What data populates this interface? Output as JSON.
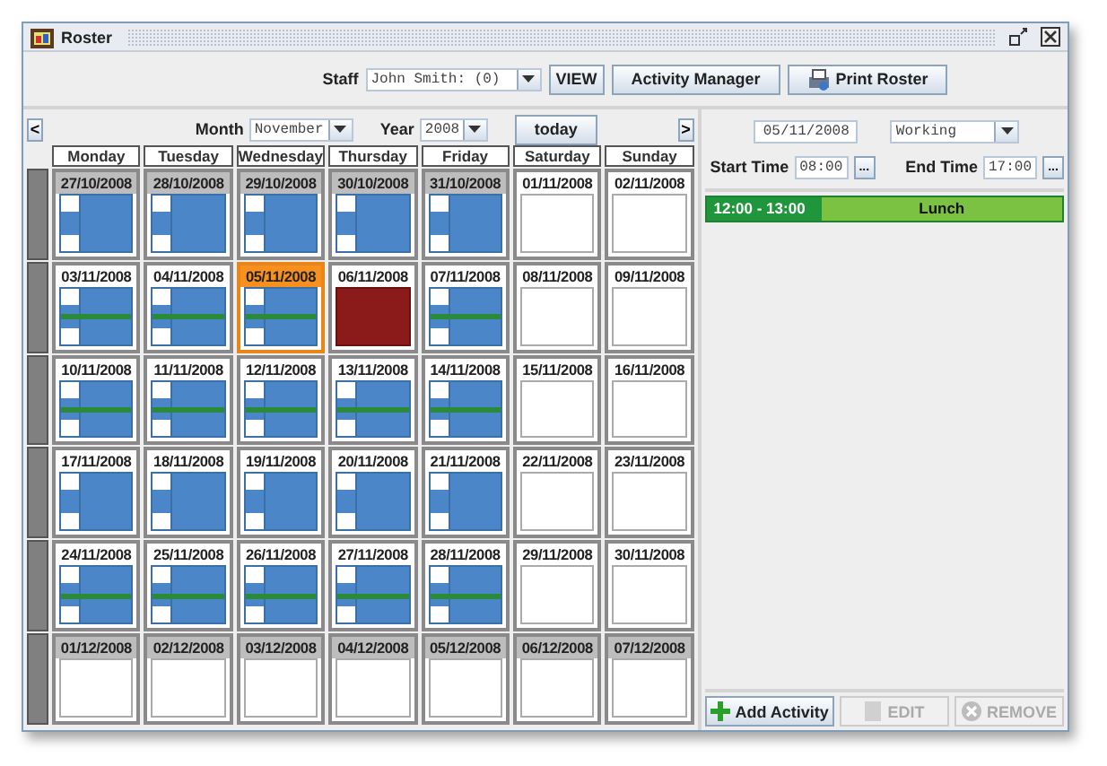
{
  "window": {
    "title": "Roster"
  },
  "toolbar": {
    "staff_label": "Staff",
    "staff_value": "John Smith: (0)",
    "buttons": [
      "VIEW",
      "Activity Manager",
      "Print Roster"
    ]
  },
  "calendar": {
    "prev": "<",
    "next": ">",
    "month_label": "Month",
    "month": "November",
    "year_label": "Year",
    "year": "2008",
    "today": "today",
    "weekdays": [
      "Monday",
      "Tuesday",
      "Wednesday",
      "Thursday",
      "Friday",
      "Saturday",
      "Sunday"
    ],
    "weeks": [
      [
        {
          "date": "27/10/2008",
          "kind": "work",
          "lunch": false,
          "outside": true,
          "selected": false
        },
        {
          "date": "28/10/2008",
          "kind": "work",
          "lunch": false,
          "outside": true,
          "selected": false
        },
        {
          "date": "29/10/2008",
          "kind": "work",
          "lunch": false,
          "outside": true,
          "selected": false
        },
        {
          "date": "30/10/2008",
          "kind": "work",
          "lunch": false,
          "outside": true,
          "selected": false
        },
        {
          "date": "31/10/2008",
          "kind": "work",
          "lunch": false,
          "outside": true,
          "selected": false
        },
        {
          "date": "01/11/2008",
          "kind": "off",
          "outside": false,
          "selected": false
        },
        {
          "date": "02/11/2008",
          "kind": "off",
          "outside": false,
          "selected": false
        }
      ],
      [
        {
          "date": "03/11/2008",
          "kind": "work",
          "lunch": true,
          "outside": false,
          "selected": false
        },
        {
          "date": "04/11/2008",
          "kind": "work",
          "lunch": true,
          "outside": false,
          "selected": false
        },
        {
          "date": "05/11/2008",
          "kind": "work",
          "lunch": true,
          "outside": false,
          "selected": true
        },
        {
          "date": "06/11/2008",
          "kind": "absence",
          "outside": false,
          "selected": false
        },
        {
          "date": "07/11/2008",
          "kind": "work",
          "lunch": true,
          "outside": false,
          "selected": false
        },
        {
          "date": "08/11/2008",
          "kind": "off",
          "outside": false,
          "selected": false
        },
        {
          "date": "09/11/2008",
          "kind": "off",
          "outside": false,
          "selected": false
        }
      ],
      [
        {
          "date": "10/11/2008",
          "kind": "work",
          "lunch": true,
          "outside": false,
          "selected": false
        },
        {
          "date": "11/11/2008",
          "kind": "work",
          "lunch": true,
          "outside": false,
          "selected": false
        },
        {
          "date": "12/11/2008",
          "kind": "work",
          "lunch": true,
          "outside": false,
          "selected": false
        },
        {
          "date": "13/11/2008",
          "kind": "work",
          "lunch": true,
          "outside": false,
          "selected": false
        },
        {
          "date": "14/11/2008",
          "kind": "work",
          "lunch": true,
          "outside": false,
          "selected": false
        },
        {
          "date": "15/11/2008",
          "kind": "off",
          "outside": false,
          "selected": false
        },
        {
          "date": "16/11/2008",
          "kind": "off",
          "outside": false,
          "selected": false
        }
      ],
      [
        {
          "date": "17/11/2008",
          "kind": "work",
          "lunch": false,
          "outside": false,
          "selected": false
        },
        {
          "date": "18/11/2008",
          "kind": "work",
          "lunch": false,
          "outside": false,
          "selected": false
        },
        {
          "date": "19/11/2008",
          "kind": "work",
          "lunch": false,
          "outside": false,
          "selected": false
        },
        {
          "date": "20/11/2008",
          "kind": "work",
          "lunch": false,
          "outside": false,
          "selected": false
        },
        {
          "date": "21/11/2008",
          "kind": "work",
          "lunch": false,
          "outside": false,
          "selected": false
        },
        {
          "date": "22/11/2008",
          "kind": "off",
          "outside": false,
          "selected": false
        },
        {
          "date": "23/11/2008",
          "kind": "off",
          "outside": false,
          "selected": false
        }
      ],
      [
        {
          "date": "24/11/2008",
          "kind": "work",
          "lunch": true,
          "outside": false,
          "selected": false
        },
        {
          "date": "25/11/2008",
          "kind": "work",
          "lunch": true,
          "outside": false,
          "selected": false
        },
        {
          "date": "26/11/2008",
          "kind": "work",
          "lunch": true,
          "outside": false,
          "selected": false
        },
        {
          "date": "27/11/2008",
          "kind": "work",
          "lunch": true,
          "outside": false,
          "selected": false
        },
        {
          "date": "28/11/2008",
          "kind": "work",
          "lunch": true,
          "outside": false,
          "selected": false
        },
        {
          "date": "29/11/2008",
          "kind": "off",
          "outside": false,
          "selected": false
        },
        {
          "date": "30/11/2008",
          "kind": "off",
          "outside": false,
          "selected": false
        }
      ],
      [
        {
          "date": "01/12/2008",
          "kind": "off",
          "outside": true,
          "selected": false
        },
        {
          "date": "02/12/2008",
          "kind": "off",
          "outside": true,
          "selected": false
        },
        {
          "date": "03/12/2008",
          "kind": "off",
          "outside": true,
          "selected": false
        },
        {
          "date": "04/12/2008",
          "kind": "off",
          "outside": true,
          "selected": false
        },
        {
          "date": "05/12/2008",
          "kind": "off",
          "outside": true,
          "selected": false
        },
        {
          "date": "06/12/2008",
          "kind": "off",
          "outside": true,
          "selected": false
        },
        {
          "date": "07/12/2008",
          "kind": "off",
          "outside": true,
          "selected": false
        }
      ]
    ]
  },
  "day_panel": {
    "date": "05/11/2008",
    "status": "Working",
    "start_label": "Start Time",
    "start": "08:00",
    "start_browse": "...",
    "end_label": "End Time",
    "end": "17:00",
    "end_browse": "...",
    "activities": [
      {
        "time": "12:00 - 13:00",
        "name": "Lunch"
      }
    ],
    "buttons": [
      {
        "label": "Add Activity",
        "disabled": false
      },
      {
        "label": "EDIT",
        "disabled": true
      },
      {
        "label": "REMOVE",
        "disabled": true
      }
    ]
  }
}
